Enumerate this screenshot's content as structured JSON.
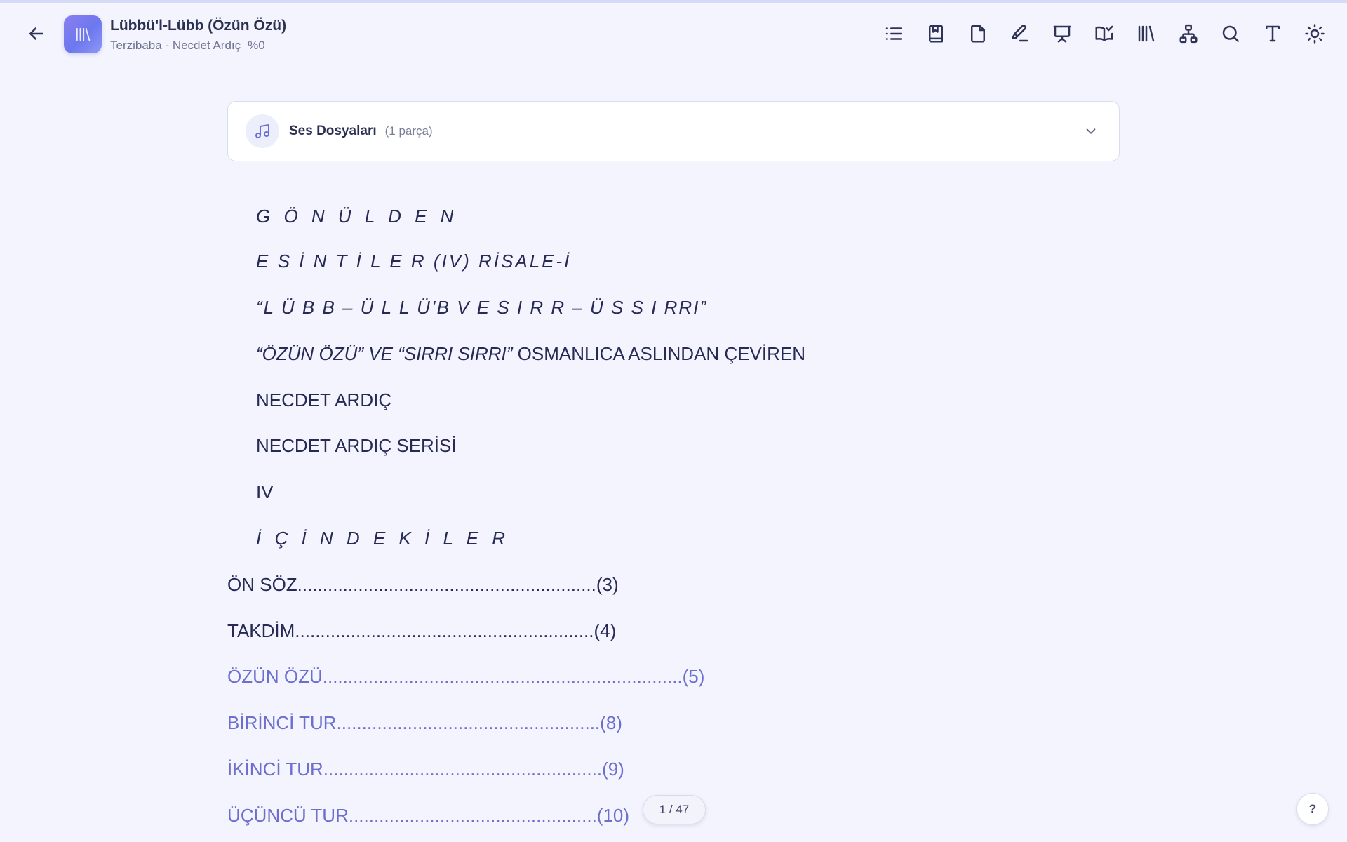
{
  "header": {
    "title": "Lübbü'l-Lübb (Özün Özü)",
    "subtitle": "Terzibaba - Necdet Ardıç",
    "progress": "%0"
  },
  "toolbar": {
    "icons": [
      "list-icon",
      "bookmark-icon",
      "note-icon",
      "highlighter-icon",
      "presentation-icon",
      "read-check-icon",
      "library-icon",
      "sitemap-icon",
      "search-icon",
      "font-icon",
      "theme-sun-icon"
    ]
  },
  "audio": {
    "title": "Ses Dosyaları",
    "count": "(1 parça)"
  },
  "document": {
    "lines": [
      "G Ö N Ü L D E N",
      "E S İ N T İ L E R (IV) RİSALE-İ",
      "“L Ü B B – Ü L L Ü’B V E S I R R – Ü S S I RRI”",
      "“ÖZÜN ÖZÜ” VE “SIRRI SIRRI”",
      " OSMANLICA ASLINDAN ÇEVİREN",
      "NECDET ARDIÇ",
      "NECDET ARDIÇ SERİSİ",
      "IV",
      "İ Ç İ N D E K İ L E R"
    ],
    "toc": [
      "ÖN SÖZ...........................................................(3)",
      "TAKDİM...........................................................(4)",
      "ÖZÜN ÖZÜ.......................................................................(5)",
      "BİRİNCİ TUR....................................................(8)",
      "İKİNCİ TUR.......................................................(9)",
      "ÜÇÜNCÜ TUR.................................................(10)"
    ]
  },
  "footer": {
    "page_indicator": "1 / 47",
    "help": "?"
  }
}
